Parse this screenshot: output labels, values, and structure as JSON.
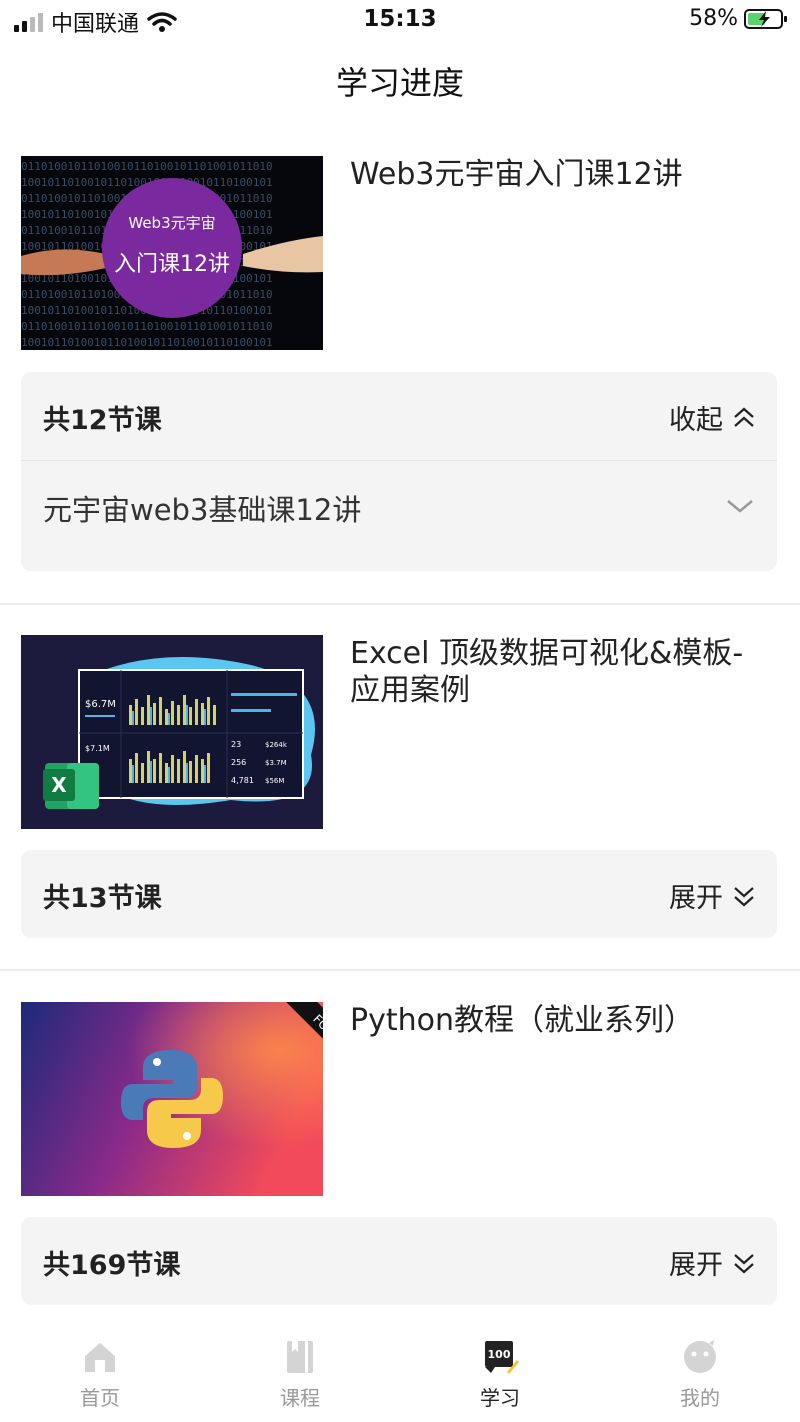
{
  "status_bar": {
    "carrier": "中国联通",
    "time": "15:13",
    "battery": "58%"
  },
  "page": {
    "title": "学习进度"
  },
  "courses": [
    {
      "title": "Web3元宇宙入门课12讲",
      "thumb_line1": "Web3元宇宙",
      "thumb_line2": "入门课12讲",
      "lesson_count": "共12节课",
      "toggle_label": "收起",
      "expanded": true,
      "sub_items": [
        "元宇宙web3基础课12讲"
      ]
    },
    {
      "title": "Excel 顶级数据可视化&模板-应用案例",
      "thumb_stat1": "$6.7M",
      "thumb_stat2": "$7.1M",
      "thumb_stat3": "23",
      "thumb_stat4": "$264k",
      "thumb_stat5": "256",
      "thumb_stat6": "$3.7M",
      "thumb_stat7": "4,781",
      "thumb_stat8": "$56M",
      "lesson_count": "共13节课",
      "toggle_label": "展开",
      "expanded": false
    },
    {
      "title": "Python教程（就业系列）",
      "thumb_ribbon": "FOR DEVEL",
      "lesson_count": "共169节课",
      "toggle_label": "展开",
      "expanded": false
    }
  ],
  "tabbar": {
    "items": [
      {
        "label": "首页",
        "icon": "home-icon",
        "active": false
      },
      {
        "label": "课程",
        "icon": "book-icon",
        "active": false
      },
      {
        "label": "学习",
        "icon": "study-100-icon",
        "active": true
      },
      {
        "label": "我的",
        "icon": "profile-icon",
        "active": false
      }
    ]
  },
  "colors": {
    "panel_bg": "#f4f4f4",
    "text": "#222222",
    "tab_inactive": "#999999",
    "web3_purple": "#7a2a9e",
    "excel_navy": "#1c1b3d",
    "excel_green": "#1f7a3f"
  }
}
